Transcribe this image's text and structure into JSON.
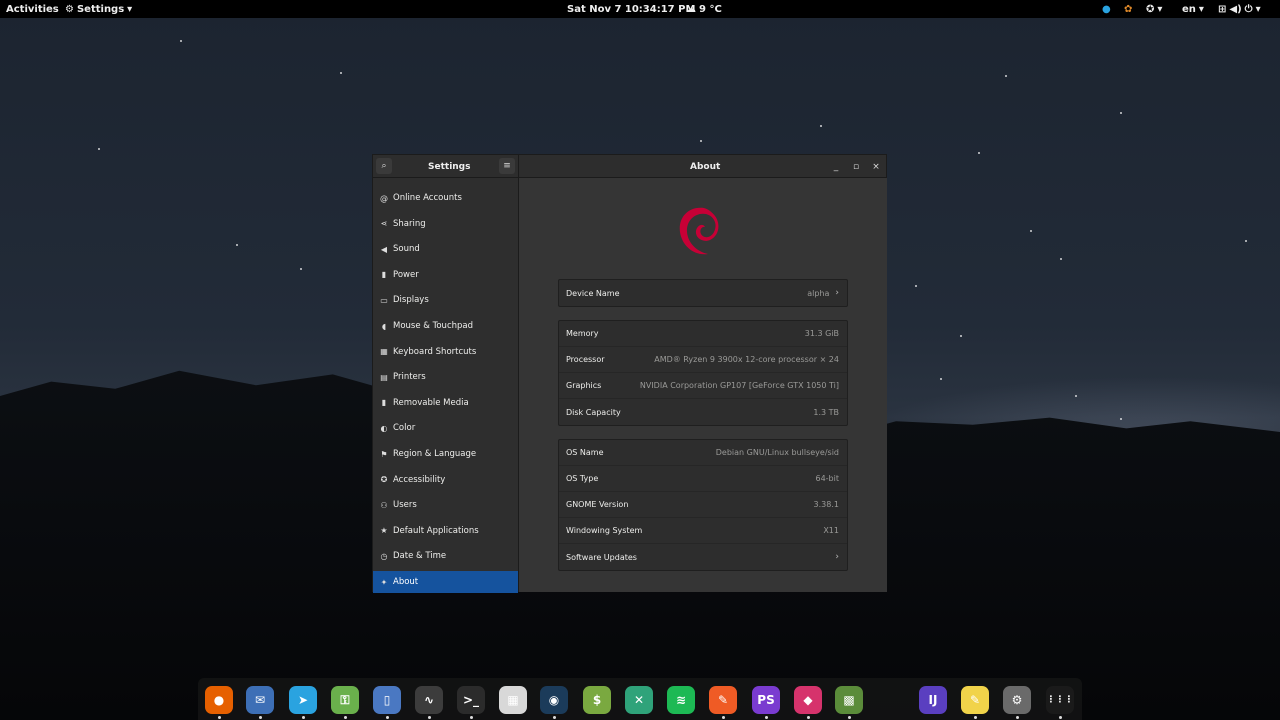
{
  "topbar": {
    "activities": "Activities",
    "app_menu": "Settings",
    "clock": "Sat Nov 7  10:34:17 PM",
    "weather": "9 °C",
    "lang": "en"
  },
  "window": {
    "sidebar_title": "Settings",
    "title": "About"
  },
  "sidebar": {
    "items": [
      {
        "label": "Online Accounts",
        "icon": "at-icon"
      },
      {
        "label": "Sharing",
        "icon": "share-icon"
      },
      {
        "label": "Sound",
        "icon": "speaker-icon"
      },
      {
        "label": "Power",
        "icon": "power-icon"
      },
      {
        "label": "Displays",
        "icon": "monitor-icon"
      },
      {
        "label": "Mouse & Touchpad",
        "icon": "mouse-icon"
      },
      {
        "label": "Keyboard Shortcuts",
        "icon": "keyboard-icon"
      },
      {
        "label": "Printers",
        "icon": "printer-icon"
      },
      {
        "label": "Removable Media",
        "icon": "usb-icon"
      },
      {
        "label": "Color",
        "icon": "color-icon"
      },
      {
        "label": "Region & Language",
        "icon": "flag-icon"
      },
      {
        "label": "Accessibility",
        "icon": "accessibility-icon"
      },
      {
        "label": "Users",
        "icon": "users-icon"
      },
      {
        "label": "Default Applications",
        "icon": "star-icon"
      },
      {
        "label": "Date & Time",
        "icon": "clock-icon"
      },
      {
        "label": "About",
        "icon": "sparkle-icon"
      }
    ],
    "active": "About"
  },
  "about": {
    "device": {
      "label": "Device Name",
      "value": "alpha"
    },
    "hardware": [
      {
        "label": "Memory",
        "value": "31.3 GiB"
      },
      {
        "label": "Processor",
        "value": "AMD® Ryzen 9 3900x 12-core processor × 24"
      },
      {
        "label": "Graphics",
        "value": "NVIDIA Corporation GP107 [GeForce GTX 1050 Ti]"
      },
      {
        "label": "Disk Capacity",
        "value": "1.3 TB"
      }
    ],
    "software": [
      {
        "label": "OS Name",
        "value": "Debian GNU/Linux bullseye/sid"
      },
      {
        "label": "OS Type",
        "value": "64-bit"
      },
      {
        "label": "GNOME Version",
        "value": "3.38.1"
      },
      {
        "label": "Windowing System",
        "value": "X11"
      },
      {
        "label": "Software Updates",
        "value": ""
      }
    ]
  },
  "dock": {
    "apps": [
      {
        "name": "firefox",
        "color": "#e66000",
        "glyph": "●"
      },
      {
        "name": "mail",
        "color": "#3d6fb6",
        "glyph": "✉"
      },
      {
        "name": "telegram",
        "color": "#2aa3e0",
        "glyph": "➤"
      },
      {
        "name": "keepass",
        "color": "#6ab04c",
        "glyph": "⚿"
      },
      {
        "name": "files",
        "color": "#4a78c2",
        "glyph": "▯"
      },
      {
        "name": "system-monitor",
        "color": "#3c3c3c",
        "glyph": "∿"
      },
      {
        "name": "terminal",
        "color": "#2b2b2b",
        "glyph": ">_"
      },
      {
        "name": "calculator",
        "color": "#d8d8d8",
        "glyph": "▦"
      },
      {
        "name": "steam",
        "color": "#1b3b5a",
        "glyph": "◉"
      },
      {
        "name": "finance",
        "color": "#7aa940",
        "glyph": "$"
      },
      {
        "name": "crossover",
        "color": "#2fa37a",
        "glyph": "✕"
      },
      {
        "name": "spotify",
        "color": "#1db954",
        "glyph": "≋"
      },
      {
        "name": "postman",
        "color": "#ef5b25",
        "glyph": "✎"
      },
      {
        "name": "phpstorm",
        "color": "#7a3bd0",
        "glyph": "PS"
      },
      {
        "name": "jetbrains-toolbox",
        "color": "#d6336c",
        "glyph": "◆"
      },
      {
        "name": "minecraft",
        "color": "#5b8c3a",
        "glyph": "▩"
      },
      {
        "name": "intellij",
        "color": "#5a3fc0",
        "glyph": "IJ"
      },
      {
        "name": "text-editor",
        "color": "#f1d34a",
        "glyph": "✎"
      },
      {
        "name": "settings",
        "color": "#6a6a6a",
        "glyph": "⚙"
      },
      {
        "name": "app-grid",
        "color": "#1a1a1a",
        "glyph": "⋮⋮⋮"
      }
    ]
  }
}
